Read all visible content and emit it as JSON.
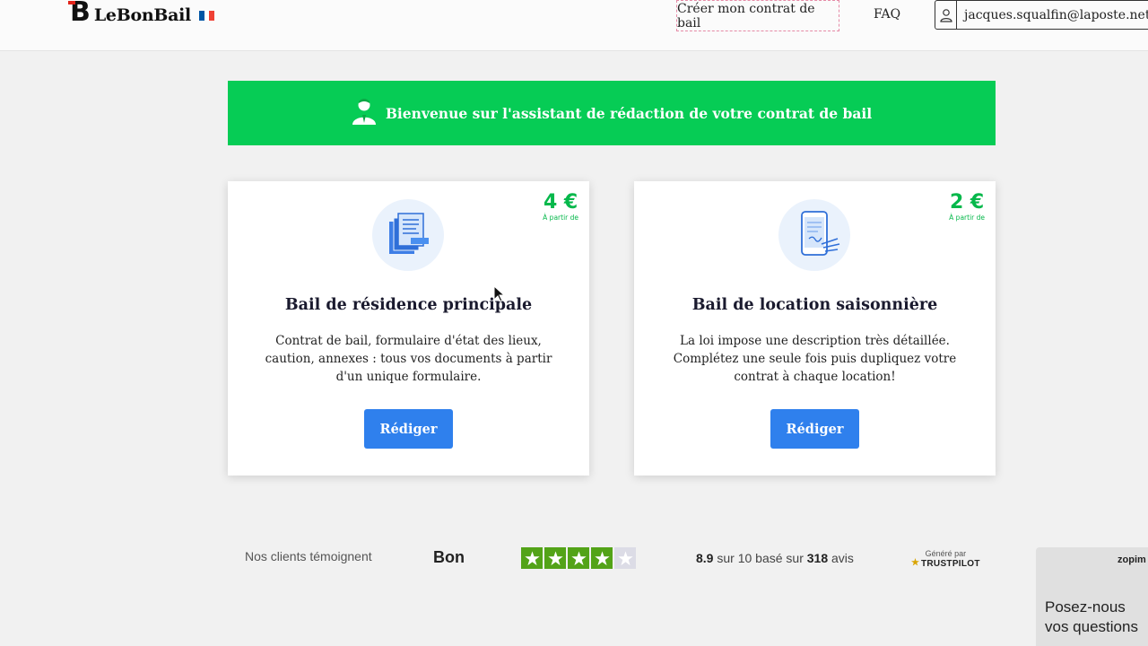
{
  "header": {
    "logo_letter": "B",
    "logo_text": "LeBonBail",
    "flag_colors": [
      "#0055a4",
      "#ffffff",
      "#ef4135"
    ],
    "nav_create_label": "Créer mon contrat de bail",
    "nav_faq_label": "FAQ",
    "user_email": "jacques.squalfin@laposte.net"
  },
  "banner": {
    "text": "Bienvenue sur l'assistant de rédaction de votre contrat de bail",
    "icon": "user-agent-icon",
    "color": "#06cc55"
  },
  "cards": [
    {
      "icon": "documents-icon",
      "price": "4 €",
      "price_note": "À partir de",
      "title": "Bail de résidence principale",
      "description": "Contrat de bail, formulaire d'état des lieux, caution, annexes : tous vos documents à partir d'un unique formulaire.",
      "button_label": "Rédiger"
    },
    {
      "icon": "phone-signature-icon",
      "price": "2 €",
      "price_note": "À partir de",
      "title": "Bail de location saisonnière",
      "description": "La loi impose une description très détaillée. Complétez une seule fois puis dupliquez votre contrat à chaque location!",
      "button_label": "Rédiger"
    }
  ],
  "trustpilot": {
    "label": "Nos clients témoignent",
    "rating_word": "Bon",
    "stars_filled": 4,
    "stars_total": 5,
    "score": "8.9",
    "score_mid": "sur 10 basé sur",
    "review_count": "318",
    "reviews_word": "avis",
    "generated_label": "Généré par",
    "brand": "TRUSTPILOT",
    "star_color": "#00b67a"
  },
  "chat": {
    "brand": "zopim",
    "text": "Posez-nous vos questions"
  },
  "colors": {
    "accent_blue": "#2f80ed",
    "green": "#06cc55",
    "price_green": "#06b84b"
  }
}
